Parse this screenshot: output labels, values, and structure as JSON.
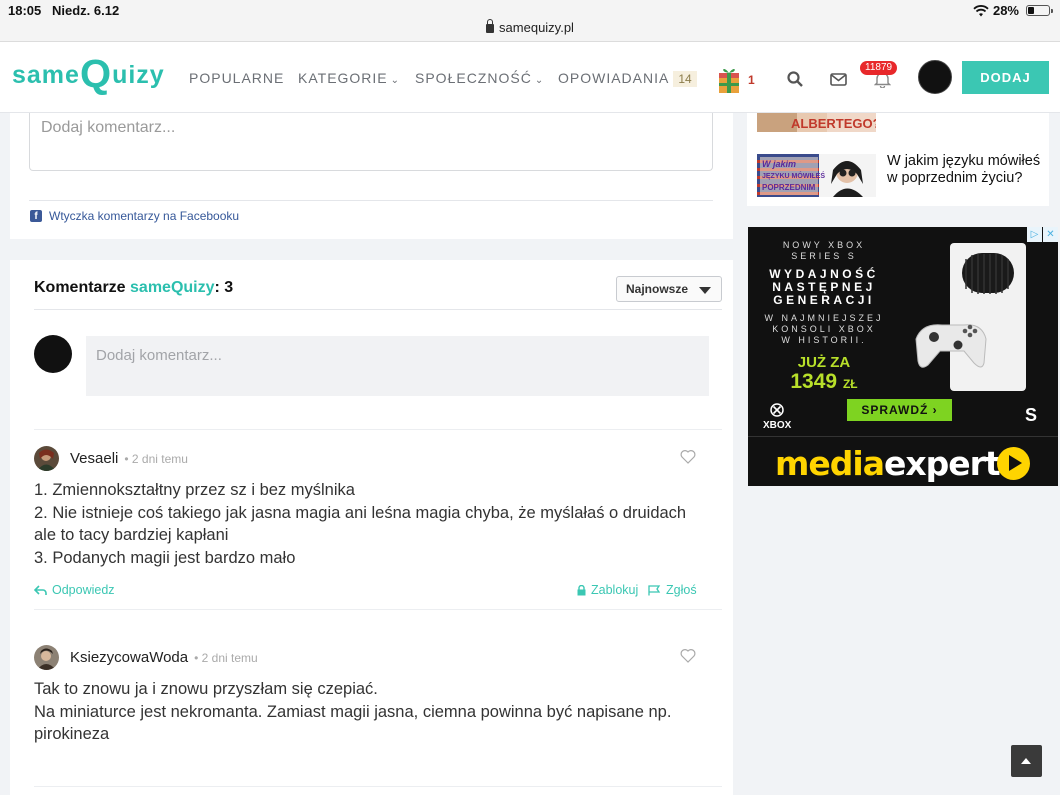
{
  "statusbar": {
    "time": "18:05",
    "date": "Niedz. 6.12",
    "url": "samequizy.pl",
    "battery": "28%"
  },
  "nav": {
    "logo_a": "same",
    "logo_b": "Q",
    "logo_c": "uizy",
    "items": [
      {
        "label": "POPULARNE"
      },
      {
        "label": "KATEGORIE"
      },
      {
        "label": "SPOŁECZNOŚĆ"
      },
      {
        "label": "OPOWIADANIA",
        "badge": "14"
      }
    ],
    "gift_count": "1",
    "notifications": "11879",
    "add_button": "DODAJ"
  },
  "fb_section": {
    "placeholder": "Dodaj komentarz...",
    "plugin_text": "Wtyczka komentarzy na Facebooku"
  },
  "comments_section": {
    "title_prefix": "Komentarze ",
    "brand": "sameQuizy",
    "title_suffix": ": 3",
    "sort_label": "Najnowsze",
    "new_comment_placeholder": "Dodaj komentarz..."
  },
  "comments": [
    {
      "user": "Vesaeli",
      "time": "• 2 dni temu",
      "lines": [
        "1. Zmiennokształtny przez sz i bez myślnika",
        "2. Nie istnieje coś takiego jak jasna magia ani leśna magia chyba, że myślałaś o druidach",
        "ale to tacy bardziej kapłani",
        "3. Podanych magii jest bardzo mało"
      ],
      "reply": "Odpowiedz",
      "block": "Zablokuj",
      "report": "Zgłoś"
    },
    {
      "user": "KsiezycowaWoda",
      "time": "• 2 dni temu",
      "lines": [
        "Tak to znowu ja i znowu przyszłam się czepiać.",
        "Na miniaturce jest nekromanta. Zamiast magii jasna, ciemna powinna być napisane np.",
        "pirokineza"
      ]
    }
  ],
  "sidebar": {
    "related_title": "W jakim języku mówiłeś w poprzednim życiu?",
    "thumb1_text": "ALBERTEGO?",
    "thumb2_text": "W jakim JĘZYKU MÓWIŁEŚ W POPRZEDNIM"
  },
  "ad": {
    "l1": "NOWY XBOX",
    "l2": "SERIES S",
    "l3": "WYDAJNOŚĆ",
    "l4": "NASTĘPNEJ",
    "l5": "GENERACJI",
    "l6": "W NAJMNIEJSZEJ",
    "l7": "KONSOLI XBOX",
    "l8": "W HISTORII.",
    "price_a": "JUŻ ZA",
    "price_b": "1349",
    "price_unit": "ZŁ",
    "cta": "SPRAWDŹ  ›",
    "xbox": "XBOX",
    "series_s": "S",
    "brand_a": "media",
    "brand_b": "expert"
  },
  "colors": {
    "accent": "#3bc7b3",
    "brand": "#2bbfae",
    "notif": "#e8282b",
    "ad_yellow": "#ffd400"
  }
}
